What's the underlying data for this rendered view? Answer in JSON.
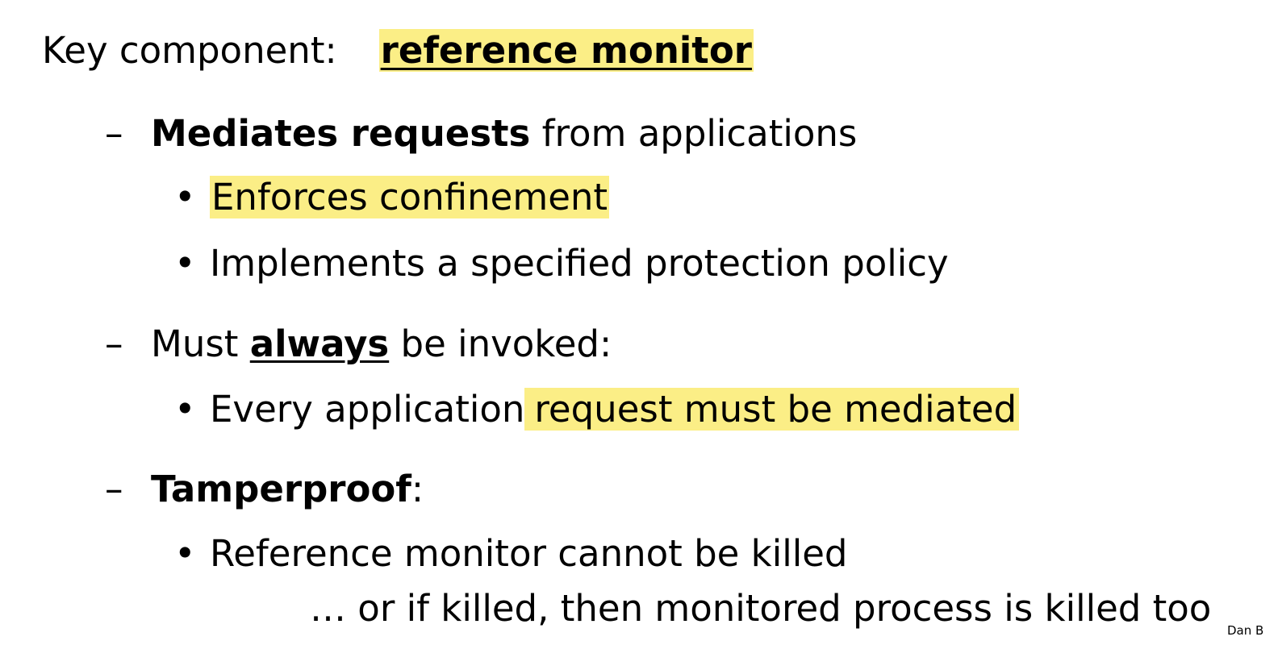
{
  "heading": {
    "label": "Key component:",
    "term": "reference monitor"
  },
  "points": [
    {
      "dash": "–",
      "bold": "Mediates requests",
      "rest": " from applications",
      "bullets": [
        {
          "dot": "•",
          "text": "Enforces confinement"
        },
        {
          "dot": "•",
          "text": "Implements a specified protection policy"
        }
      ]
    },
    {
      "dash": "–",
      "pre": "Must ",
      "emph": "always",
      "rest": " be invoked:",
      "bullets": [
        {
          "dot": "•",
          "plain": "Every application",
          "highlight": "request must be mediated"
        }
      ]
    },
    {
      "dash": "–",
      "bold": "Tamperproof",
      "rest": ":",
      "bullets": [
        {
          "dot": "•",
          "text": "Reference monitor cannot be killed"
        }
      ]
    }
  ],
  "continuation": "… or if killed, then monitored process is killed too",
  "author_fragment": "Dan B",
  "colors": {
    "highlight": "#fbee86",
    "text": "#000000",
    "background": "#ffffff"
  }
}
